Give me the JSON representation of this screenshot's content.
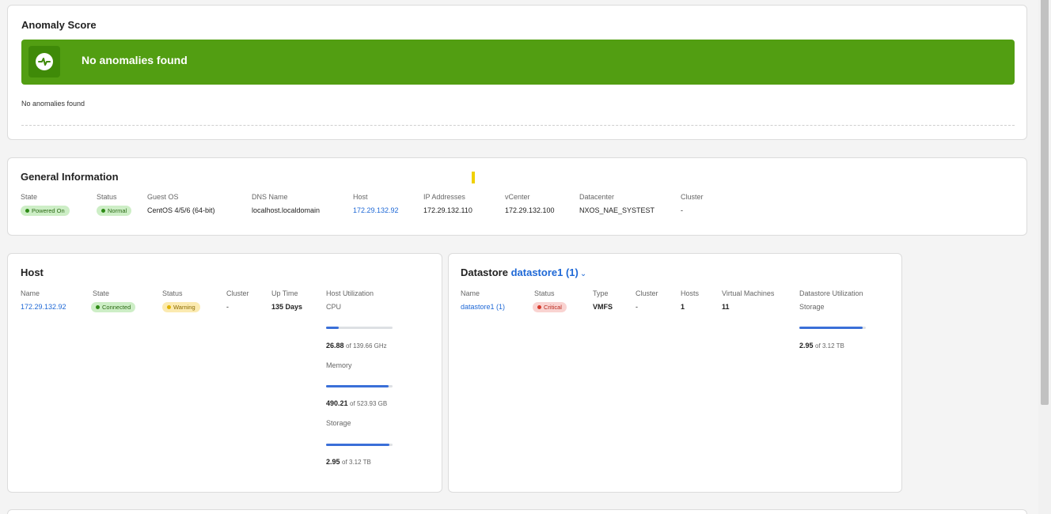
{
  "anomaly": {
    "title": "Anomaly Score",
    "banner_text": "No anomalies found",
    "note": "No anomalies found",
    "banner_color": "#529e12"
  },
  "general": {
    "title": "General Information",
    "fields": {
      "state": {
        "label": "State",
        "value": "Powered On"
      },
      "status": {
        "label": "Status",
        "value": "Normal"
      },
      "guest_os": {
        "label": "Guest OS",
        "value": "CentOS 4/5/6 (64-bit)"
      },
      "dns_name": {
        "label": "DNS Name",
        "value": "localhost.localdomain"
      },
      "host": {
        "label": "Host",
        "value": "172.29.132.92"
      },
      "ip": {
        "label": "IP Addresses",
        "value": "172.29.132.110"
      },
      "vcenter": {
        "label": "vCenter",
        "value": "172.29.132.100"
      },
      "datacenter": {
        "label": "Datacenter",
        "value": "NXOS_NAE_SYSTEST"
      },
      "cluster": {
        "label": "Cluster",
        "value": "-"
      }
    }
  },
  "host": {
    "title": "Host",
    "labels": {
      "name": "Name",
      "state": "State",
      "status": "Status",
      "cluster": "Cluster",
      "uptime": "Up Time",
      "util": "Host Utilization"
    },
    "values": {
      "name": "172.29.132.92",
      "state": "Connected",
      "status": "Warning",
      "cluster": "-",
      "uptime": "135 Days"
    },
    "utilization": {
      "cpu": {
        "label": "CPU",
        "used": "26.88",
        "total": "of 139.66 GHz",
        "fraction": 0.19
      },
      "memory": {
        "label": "Memory",
        "used": "490.21",
        "total": "of 523.93 GB",
        "fraction": 0.94
      },
      "storage": {
        "label": "Storage",
        "used": "2.95",
        "total": "of 3.12 TB",
        "fraction": 0.95
      }
    }
  },
  "datastore": {
    "title_prefix": "Datastore",
    "title_link": "datastore1 (1)",
    "labels": {
      "name": "Name",
      "status": "Status",
      "type": "Type",
      "cluster": "Cluster",
      "hosts": "Hosts",
      "vms": "Virtual Machines",
      "util": "Datastore Utilization"
    },
    "values": {
      "name": "datastore1 (1)",
      "status": "Critical",
      "type": "VMFS",
      "cluster": "-",
      "hosts": "1",
      "vms": "11"
    },
    "utilization": {
      "storage": {
        "label": "Storage",
        "used": "2.95",
        "total": "of 3.12 TB",
        "fraction": 0.95
      }
    }
  }
}
